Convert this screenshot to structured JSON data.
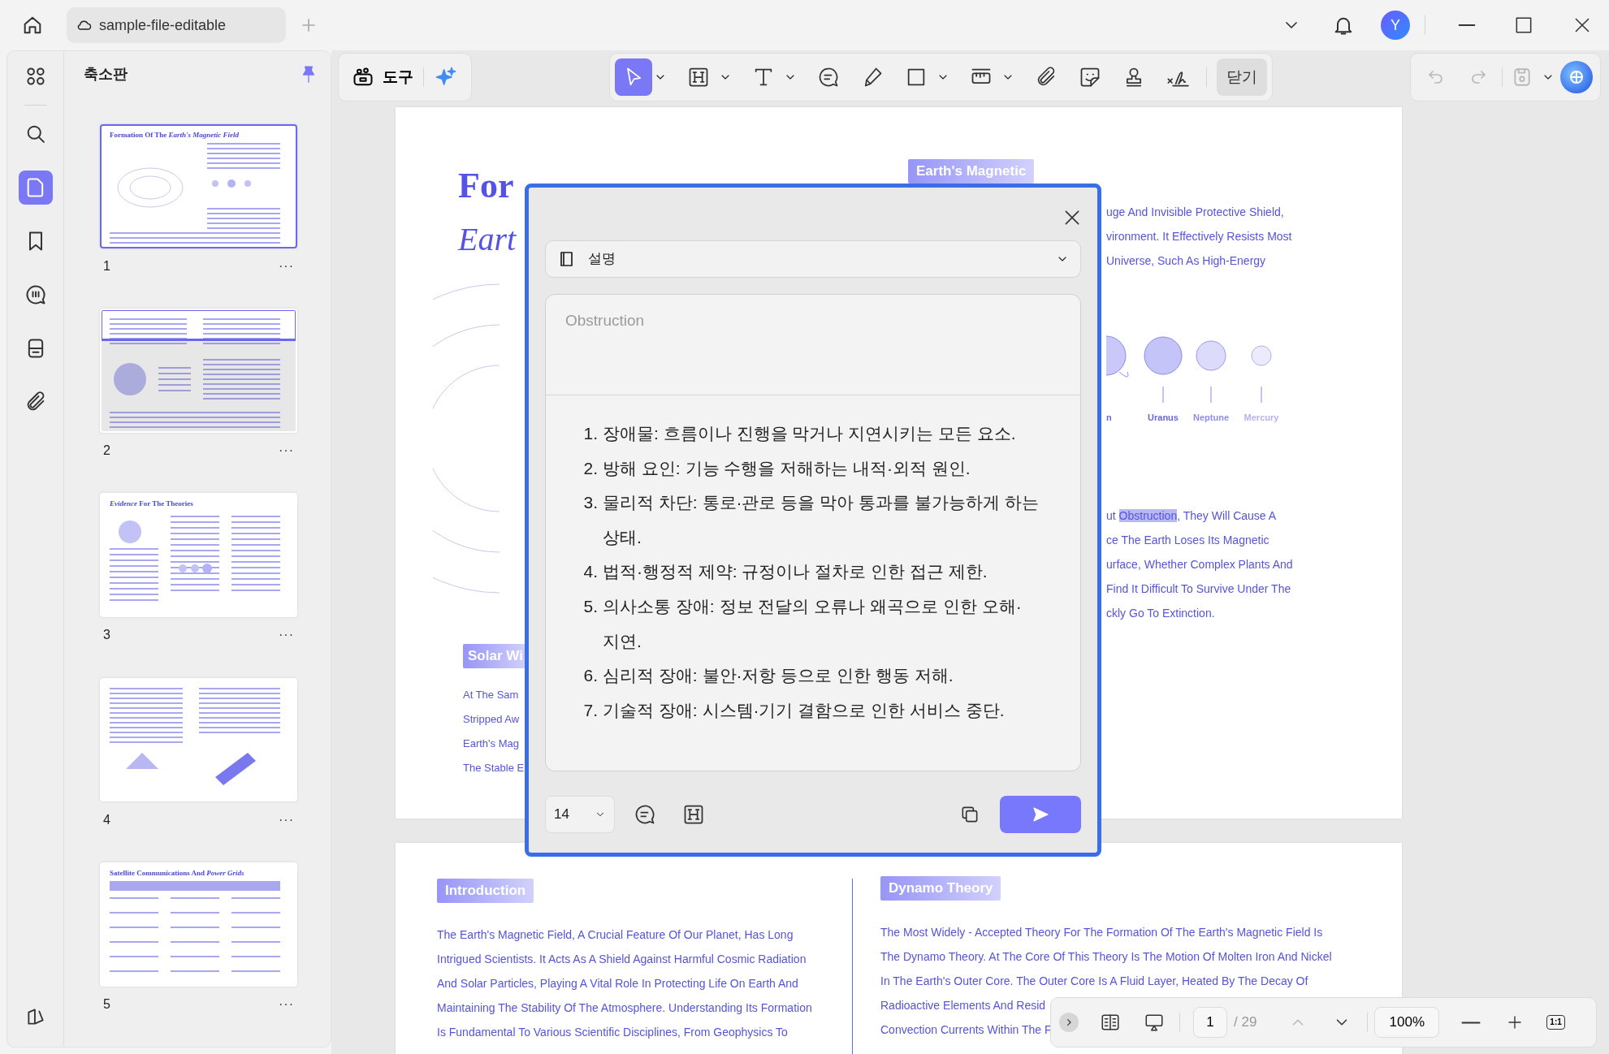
{
  "title_bar": {
    "tab_title": "sample-file-editable",
    "avatar_initial": "Y"
  },
  "rail": [
    {
      "kind": "grid",
      "selected": false
    },
    {
      "kind": "search",
      "selected": false
    },
    {
      "kind": "page",
      "selected": true
    },
    {
      "kind": "bookmark",
      "selected": false
    },
    {
      "kind": "comment",
      "selected": false
    },
    {
      "kind": "form",
      "selected": false
    },
    {
      "kind": "attachment",
      "selected": false
    }
  ],
  "sidebar": {
    "title": "축소판",
    "pinned": true,
    "thumbnails": [
      {
        "number": "1",
        "more": "···",
        "selected": true,
        "partly_in_view": false,
        "heading": "Formation Of The *Earth's Magnetic Field*"
      },
      {
        "number": "2",
        "more": "···",
        "selected": false,
        "partly_in_view": true
      },
      {
        "number": "3",
        "more": "···",
        "selected": false,
        "partly_in_view": false,
        "heading": "*Evidence* For The Theories"
      },
      {
        "number": "4",
        "more": "···",
        "selected": false,
        "partly_in_view": false
      },
      {
        "number": "5",
        "more": "···",
        "selected": false,
        "partly_in_view": false,
        "heading": "Satellite Communications And *Power Grids*"
      }
    ]
  },
  "toolbar": {
    "tools_label": "도구",
    "edit_tools": [
      {
        "kind": "select",
        "selected": true,
        "menu": true
      },
      {
        "kind": "heading",
        "selected": false,
        "menu": true
      },
      {
        "kind": "text",
        "selected": false,
        "menu": true
      },
      {
        "kind": "comment",
        "selected": false,
        "menu": false
      },
      {
        "kind": "pen",
        "selected": false,
        "menu": false
      },
      {
        "kind": "rectangle",
        "selected": false,
        "menu": true
      },
      {
        "kind": "measure",
        "selected": false,
        "menu": true
      },
      {
        "kind": "attachment",
        "selected": false,
        "menu": false
      },
      {
        "kind": "sticker",
        "selected": false,
        "menu": false
      },
      {
        "kind": "stamp",
        "selected": false,
        "menu": false
      },
      {
        "kind": "signature",
        "selected": false,
        "menu": false
      }
    ],
    "close_label": "닫기",
    "undo_disabled": true,
    "redo_disabled": true
  },
  "page_1": {
    "title": "For",
    "subtitle": "Eart",
    "badge": "Earth's Magnetic",
    "right_lines_top": [
      "uge And Invisible Protective Shield,",
      "vironment. It Effectively Resists Most",
      "Universe, Such As High-Energy"
    ],
    "planet_labels": [
      "n",
      "Uranus",
      "Neptune",
      "Mercury"
    ],
    "right_lines_bottom": [
      [
        {
          "text": "ut ",
          "highlighted": false
        },
        {
          "text": "Obstruction",
          "highlighted": true
        },
        {
          "text": ", They Will Cause A",
          "highlighted": false
        }
      ],
      [
        {
          "text": "ce The Earth Loses Its Magnetic",
          "highlighted": false
        }
      ],
      [
        {
          "text": "urface, Whether Complex Plants And",
          "highlighted": false
        }
      ],
      [
        {
          "text": "Find It Difficult To Survive Under The",
          "highlighted": false
        }
      ],
      [
        {
          "text": "ckly Go To Extinction.",
          "highlighted": false
        }
      ]
    ],
    "left_badge": "Solar Wi",
    "left_lines": [
      "At The Sam",
      "Stripped Aw",
      "Earth's Mag",
      "The Stable E"
    ]
  },
  "page_2": {
    "columns": [
      {
        "badge": "Introduction",
        "lines": [
          "The Earth's Magnetic Field, A Crucial Feature Of Our Planet, Has Long",
          "Intrigued Scientists. It Acts As A Shield Against Harmful Cosmic Radiation",
          "And Solar Particles, Playing A Vital Role In Protecting Life On Earth And",
          "Maintaining The Stability Of The Atmosphere. Understanding Its Formation",
          "Is Fundamental To Various Scientific Disciplines, From Geophysics To"
        ]
      },
      {
        "badge": "Dynamo Theory",
        "lines": [
          "The Most Widely - Accepted Theory For The Formation Of The Earth's Magnetic Field Is",
          "The Dynamo Theory. At The Core Of This Theory Is The Motion Of Molten Iron And Nickel",
          "In The Earth's Outer Core. The Outer Core Is A Fluid Layer, Heated By The Decay Of",
          "Radioactive Elements And Resid",
          "Convection Currents Within The F"
        ]
      }
    ]
  },
  "dialog": {
    "mode": "설명",
    "quote": "Obstruction",
    "items": [
      {
        "number": "1.",
        "text": "장애물: 흐름이나 진행을 막거나 지연시키는 모든 요소."
      },
      {
        "number": "2.",
        "text": "방해 요인: 기능 수행을 저해하는 내적·외적 원인."
      },
      {
        "number": "3.",
        "text": "물리적 차단: 통로·관로 등을 막아 통과를 불가능하게 하는 상태."
      },
      {
        "number": "4.",
        "text": "법적·행정적 제약: 규정이나 절차로 인한 접근 제한."
      },
      {
        "number": "5.",
        "text": "의사소통 장애: 정보 전달의 오류나 왜곡으로 인한 오해·지연."
      },
      {
        "number": "6.",
        "text": "심리적 장애: 불안·저항 등으로 인한 행동 저해."
      },
      {
        "number": "7.",
        "text": "기술적 장애: 시스템·기기 결함으로 인한 서비스 중단."
      }
    ],
    "font_size": "14"
  },
  "bottom_bar": {
    "page": "1",
    "total": "/ 29",
    "prev_disabled": true,
    "zoom": "100%",
    "actual_size": "1:1"
  }
}
